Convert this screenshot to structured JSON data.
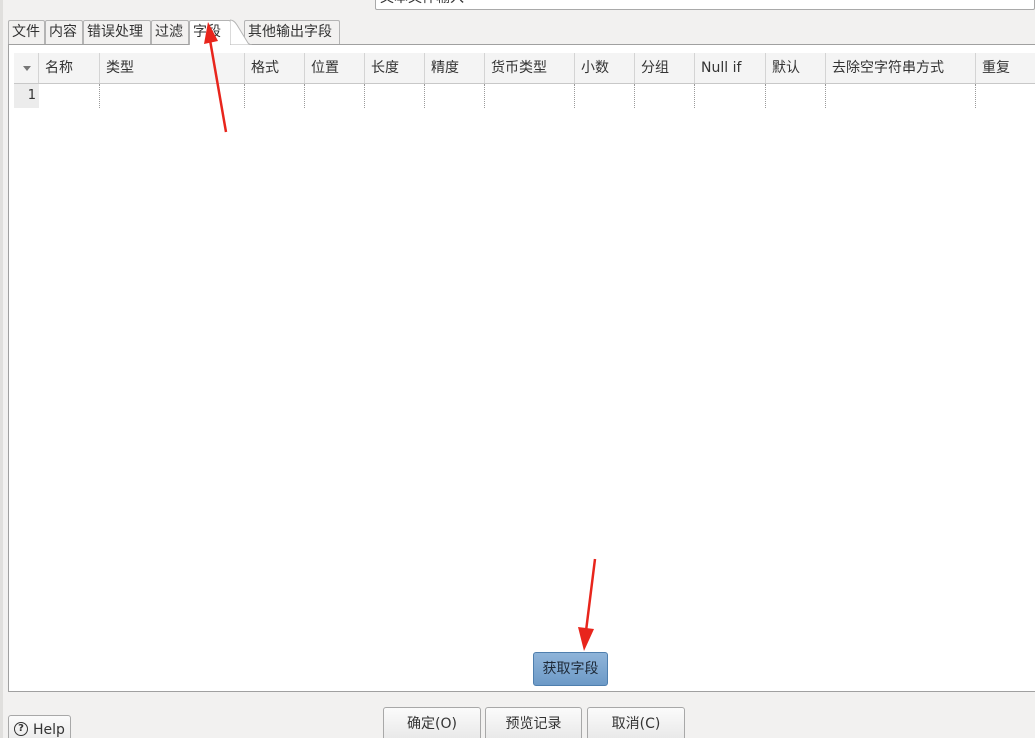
{
  "step_name_value": "文本文件输入",
  "tabs": [
    {
      "label": "文件"
    },
    {
      "label": "内容"
    },
    {
      "label": "错误处理"
    },
    {
      "label": "过滤"
    },
    {
      "label": "字段",
      "active": true
    },
    {
      "label": "其他输出字段"
    }
  ],
  "table": {
    "columns": [
      "名称",
      "类型",
      "格式",
      "位置",
      "长度",
      "精度",
      "货币类型",
      "小数",
      "分组",
      "Null if",
      "默认",
      "去除空字符串方式",
      "重复"
    ],
    "rows": [
      {
        "num": "1",
        "cells": [
          "",
          "",
          "",
          "",
          "",
          "",
          "",
          "",
          "",
          "",
          "",
          "",
          ""
        ]
      }
    ]
  },
  "buttons": {
    "get_fields": "获取字段",
    "ok": "确定(O)",
    "preview": "预览记录",
    "cancel": "取消(C)",
    "help": "Help"
  },
  "colors": {
    "annotation_arrow": "#e8251c",
    "primary_button": "#7aa6d3"
  }
}
